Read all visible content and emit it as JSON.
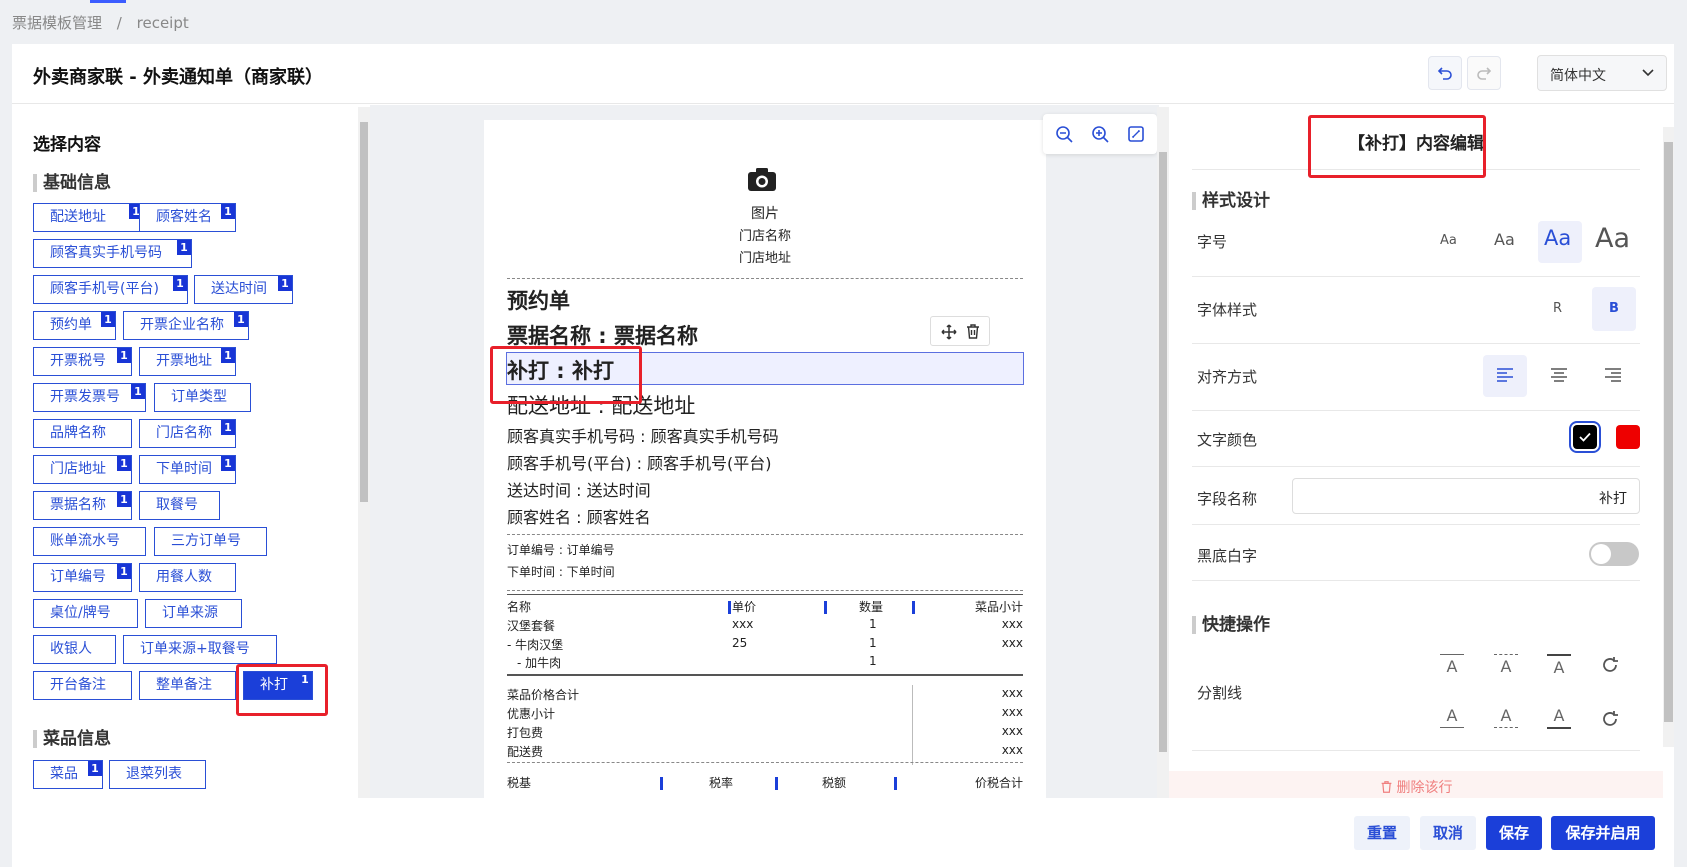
{
  "breadcrumb": {
    "root": "票据模板管理",
    "sep": "/",
    "current": "receipt"
  },
  "header": {
    "title": "外卖商家联 - 外卖通知单（商家联）",
    "language": "简体中文"
  },
  "left": {
    "title": "选择内容",
    "groups": [
      {
        "name": "基础信息"
      },
      {
        "name": "菜品信息"
      }
    ],
    "tags": [
      {
        "label": "配送地址",
        "badge": "1"
      },
      {
        "label": "顾客姓名",
        "badge": "1"
      },
      {
        "label": "顾客真实手机号码",
        "badge": "1"
      },
      {
        "label": "顾客手机号(平台)",
        "badge": "1"
      },
      {
        "label": "送达时间",
        "badge": "1"
      },
      {
        "label": "预约单",
        "badge": "1"
      },
      {
        "label": "开票企业名称",
        "badge": "1"
      },
      {
        "label": "开票税号",
        "badge": "1"
      },
      {
        "label": "开票地址",
        "badge": "1"
      },
      {
        "label": "开票发票号",
        "badge": "1"
      },
      {
        "label": "订单类型",
        "badge": ""
      },
      {
        "label": "品牌名称",
        "badge": ""
      },
      {
        "label": "门店名称",
        "badge": "1"
      },
      {
        "label": "门店地址",
        "badge": "1"
      },
      {
        "label": "下单时间",
        "badge": "1"
      },
      {
        "label": "票据名称",
        "badge": "1"
      },
      {
        "label": "取餐号",
        "badge": ""
      },
      {
        "label": "账单流水号",
        "badge": ""
      },
      {
        "label": "三方订单号",
        "badge": ""
      },
      {
        "label": "订单编号",
        "badge": "1"
      },
      {
        "label": "用餐人数",
        "badge": ""
      },
      {
        "label": "桌位/牌号",
        "badge": ""
      },
      {
        "label": "订单来源",
        "badge": ""
      },
      {
        "label": "收银人",
        "badge": ""
      },
      {
        "label": "订单来源+取餐号",
        "badge": ""
      },
      {
        "label": "开台备注",
        "badge": ""
      },
      {
        "label": "整单备注",
        "badge": ""
      },
      {
        "label": "补打",
        "badge": "1"
      },
      {
        "label": "菜品",
        "badge": "1"
      },
      {
        "label": "退菜列表",
        "badge": ""
      }
    ]
  },
  "paper": {
    "image": "图片",
    "store_name": "门店名称",
    "store_address": "门店地址",
    "lines": [
      "预约单",
      "票据名称 : 票据名称",
      "补打 : 补打",
      "配送地址 : 配送地址",
      "顾客真实手机号码 : 顾客真实手机号码",
      "顾客手机号(平台) : 顾客手机号(平台)",
      "送达时间 : 送达时间",
      "顾客姓名 : 顾客姓名",
      "订单编号 : 订单编号",
      "下单时间 : 下单时间"
    ],
    "table_headers": [
      "名称",
      "单价",
      "数量",
      "菜品小计"
    ],
    "items": [
      [
        "汉堡套餐",
        "xxx",
        "1",
        "xxx"
      ],
      [
        "- 牛肉汉堡",
        "25",
        "1",
        "xxx"
      ],
      [
        "- 加牛肉",
        "",
        "1",
        ""
      ]
    ],
    "totals": [
      [
        "菜品价格合计",
        "xxx"
      ],
      [
        "优惠小计",
        "xxx"
      ],
      [
        "打包费",
        "xxx"
      ],
      [
        "配送费",
        "xxx"
      ]
    ],
    "tax_headers": [
      "税基",
      "税率",
      "税额",
      "价税合计"
    ]
  },
  "right": {
    "title": "【补打】内容编辑",
    "style_group": "样式设计",
    "font_size_label": "字号",
    "font_sizes": [
      "Aa",
      "Aa",
      "Aa",
      "Aa"
    ],
    "font_style_label": "字体样式",
    "font_styles": [
      "R",
      "B"
    ],
    "align_label": "对齐方式",
    "color_label": "文字颜色",
    "colors": [
      "#000000",
      "#ee0000"
    ],
    "field_label": "字段名称",
    "field_value": "补打",
    "invert_label": "黑底白字",
    "quick_group": "快捷操作",
    "divider_label": "分割线",
    "divider_glyph": "A",
    "delete_label": "删除该行"
  },
  "footer": {
    "reset": "重置",
    "cancel": "取消",
    "save": "保存",
    "save_enable": "保存并启用"
  }
}
